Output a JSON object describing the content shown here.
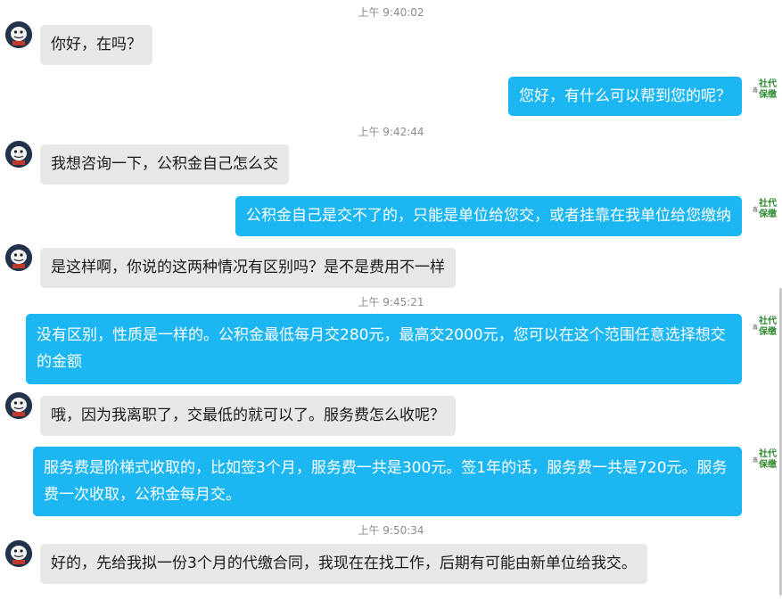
{
  "messages": [
    {
      "type": "timestamp",
      "text": "上午 9:40:02"
    },
    {
      "type": "in",
      "text": "你好，在吗？"
    },
    {
      "type": "out",
      "text": "您好，有什么可以帮到您的呢？"
    },
    {
      "type": "timestamp",
      "text": "上午 9:42:44"
    },
    {
      "type": "in",
      "text": "我想咨询一下，公积金自己怎么交"
    },
    {
      "type": "out",
      "text": "公积金自己是交不了的，只能是单位给您交，或者挂靠在我单位给您缴纳"
    },
    {
      "type": "in",
      "text": "是这样啊，你说的这两种情况有区别吗？是不是费用不一样"
    },
    {
      "type": "timestamp",
      "text": "上午 9:45:21"
    },
    {
      "type": "out",
      "text": "没有区别，性质是一样的。公积金最低每月交280元，最高交2000元，您可以在这个范围任意选择想交的金额"
    },
    {
      "type": "in",
      "text": "哦，因为我离职了，交最低的就可以了。服务费怎么收呢？"
    },
    {
      "type": "out",
      "text": "服务费是阶梯式收取的，比如签3个月，服务费一共是300元。签1年的话，服务费一共是720元。服务费一次收取，公积金每月交。"
    },
    {
      "type": "timestamp",
      "text": "上午 9:50:34"
    },
    {
      "type": "in",
      "text": "好的，先给我拟一份3个月的代缴合同，我现在在找工作，后期有可能由新单位给我交。"
    }
  ],
  "logo": {
    "line1": "社代",
    "line2": "保缴",
    "side": "鑫"
  },
  "colors": {
    "out_bubble": "#1cb6f2",
    "in_bubble": "#e8e8e8",
    "logo_green": "#2e8b2e"
  }
}
